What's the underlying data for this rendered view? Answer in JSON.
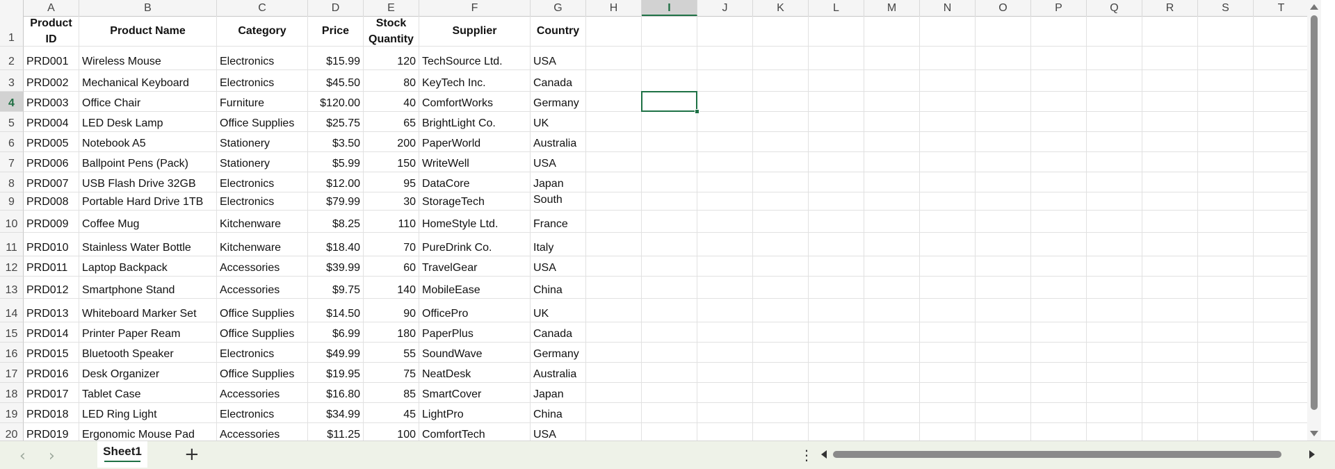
{
  "sheet": {
    "active_tab": "Sheet1",
    "add_sheet_label": "+",
    "more_label": "⋮",
    "nav_prev": "‹",
    "nav_next": "›",
    "active_cell": "I4"
  },
  "column_letters": [
    "A",
    "B",
    "C",
    "D",
    "E",
    "F",
    "G",
    "H",
    "I",
    "J",
    "K",
    "L",
    "M",
    "N",
    "O",
    "P",
    "Q",
    "R",
    "S",
    "T"
  ],
  "row_numbers": [
    "1",
    "2",
    "3",
    "4",
    "5",
    "6",
    "7",
    "8",
    "9",
    "10",
    "11",
    "12",
    "13",
    "14",
    "15",
    "16",
    "17",
    "18",
    "19",
    "20"
  ],
  "table": {
    "headers": [
      "Product ID",
      "Product Name",
      "Category",
      "Price",
      "Stock Quantity",
      "Supplier",
      "Country"
    ],
    "rows": [
      [
        "PRD001",
        "Wireless Mouse",
        "Electronics",
        "$15.99",
        "120",
        "TechSource Ltd.",
        "USA"
      ],
      [
        "PRD002",
        "Mechanical Keyboard",
        "Electronics",
        "$45.50",
        "80",
        "KeyTech Inc.",
        "Canada"
      ],
      [
        "PRD003",
        "Office Chair",
        "Furniture",
        "$120.00",
        "40",
        "ComfortWorks",
        "Germany"
      ],
      [
        "PRD004",
        "LED Desk Lamp",
        "Office Supplies",
        "$25.75",
        "65",
        "BrightLight Co.",
        "UK"
      ],
      [
        "PRD005",
        "Notebook A5",
        "Stationery",
        "$3.50",
        "200",
        "PaperWorld",
        "Australia"
      ],
      [
        "PRD006",
        "Ballpoint Pens (Pack)",
        "Stationery",
        "$5.99",
        "150",
        "WriteWell",
        "USA"
      ],
      [
        "PRD007",
        "USB Flash Drive 32GB",
        "Electronics",
        "$12.00",
        "95",
        "DataCore",
        "Japan"
      ],
      [
        "PRD008",
        "Portable Hard Drive 1TB",
        "Electronics",
        "$79.99",
        "30",
        "StorageTech",
        "South Korea"
      ],
      [
        "PRD009",
        "Coffee Mug",
        "Kitchenware",
        "$8.25",
        "110",
        "HomeStyle Ltd.",
        "France"
      ],
      [
        "PRD010",
        "Stainless Water Bottle",
        "Kitchenware",
        "$18.40",
        "70",
        "PureDrink Co.",
        "Italy"
      ],
      [
        "PRD011",
        "Laptop Backpack",
        "Accessories",
        "$39.99",
        "60",
        "TravelGear",
        "USA"
      ],
      [
        "PRD012",
        "Smartphone Stand",
        "Accessories",
        "$9.75",
        "140",
        "MobileEase",
        "China"
      ],
      [
        "PRD013",
        "Whiteboard Marker Set",
        "Office Supplies",
        "$14.50",
        "90",
        "OfficePro",
        "UK"
      ],
      [
        "PRD014",
        "Printer Paper Ream",
        "Office Supplies",
        "$6.99",
        "180",
        "PaperPlus",
        "Canada"
      ],
      [
        "PRD015",
        "Bluetooth Speaker",
        "Electronics",
        "$49.99",
        "55",
        "SoundWave",
        "Germany"
      ],
      [
        "PRD016",
        "Desk Organizer",
        "Office Supplies",
        "$19.95",
        "75",
        "NeatDesk",
        "Australia"
      ],
      [
        "PRD017",
        "Tablet Case",
        "Accessories",
        "$16.80",
        "85",
        "SmartCover",
        "Japan"
      ],
      [
        "PRD018",
        "LED Ring Light",
        "Electronics",
        "$34.99",
        "45",
        "LightPro",
        "China"
      ],
      [
        "PRD019",
        "Ergonomic Mouse Pad",
        "Accessories",
        "$11.25",
        "100",
        "ComfortTech",
        "USA"
      ]
    ]
  }
}
